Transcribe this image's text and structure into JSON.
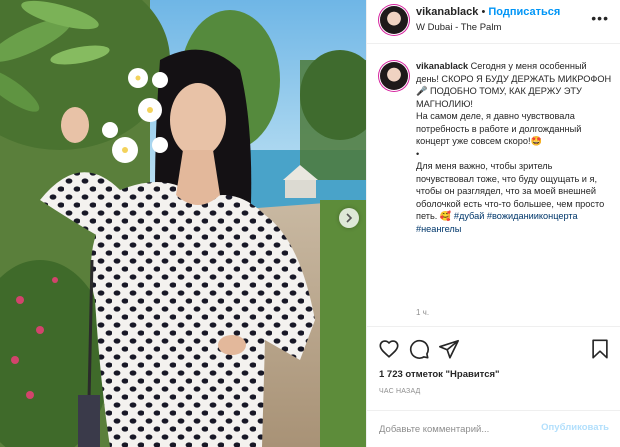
{
  "post": {
    "username": "vikanablack",
    "separator": "•",
    "follow_label": "Подписаться",
    "location": "W Dubai - The Palm",
    "more_label": "•••"
  },
  "caption": {
    "username": "vikanablack",
    "paragraph1": "Сегодня у меня особенный день! СКОРО Я БУДУ ДЕРЖАТЬ МИКРОФОН 🎤 ПОДОБНО ТОМУ, КАК ДЕРЖУ ЭТУ МАГНОЛИЮ!",
    "paragraph2": "На самом деле, я давно чувствовала потребность в работе и долгожданный концерт уже совсем скоро!🤩",
    "dot": "•",
    "paragraph3": "Для меня важно, чтобы зритель почувствовал тоже, что буду ощущать и я, чтобы он разглядел, что за моей внешней оболочкой есть что-то большее, чем просто петь. 🥰",
    "tag1": "#дубай",
    "tag2": "#вожиданииконцерта",
    "tag3": "#неангелы",
    "time": "1 ч."
  },
  "stats": {
    "likes": "1 723 отметок \"Нравится\"",
    "posted": "ЧАС НАЗАД"
  },
  "comment_box": {
    "placeholder": "Добавьте комментарий...",
    "post_label": "Опубликовать"
  },
  "icons": {
    "like": "heart-icon",
    "comment": "comment-icon",
    "share": "share-icon",
    "save": "bookmark-icon",
    "next": "chevron-right-icon"
  },
  "colors": {
    "accent": "#0095f6",
    "accent_disabled": "#b2dffc",
    "text": "#262626",
    "muted": "#8e8e8e",
    "border": "#efefef",
    "hashtag": "#00376b"
  }
}
